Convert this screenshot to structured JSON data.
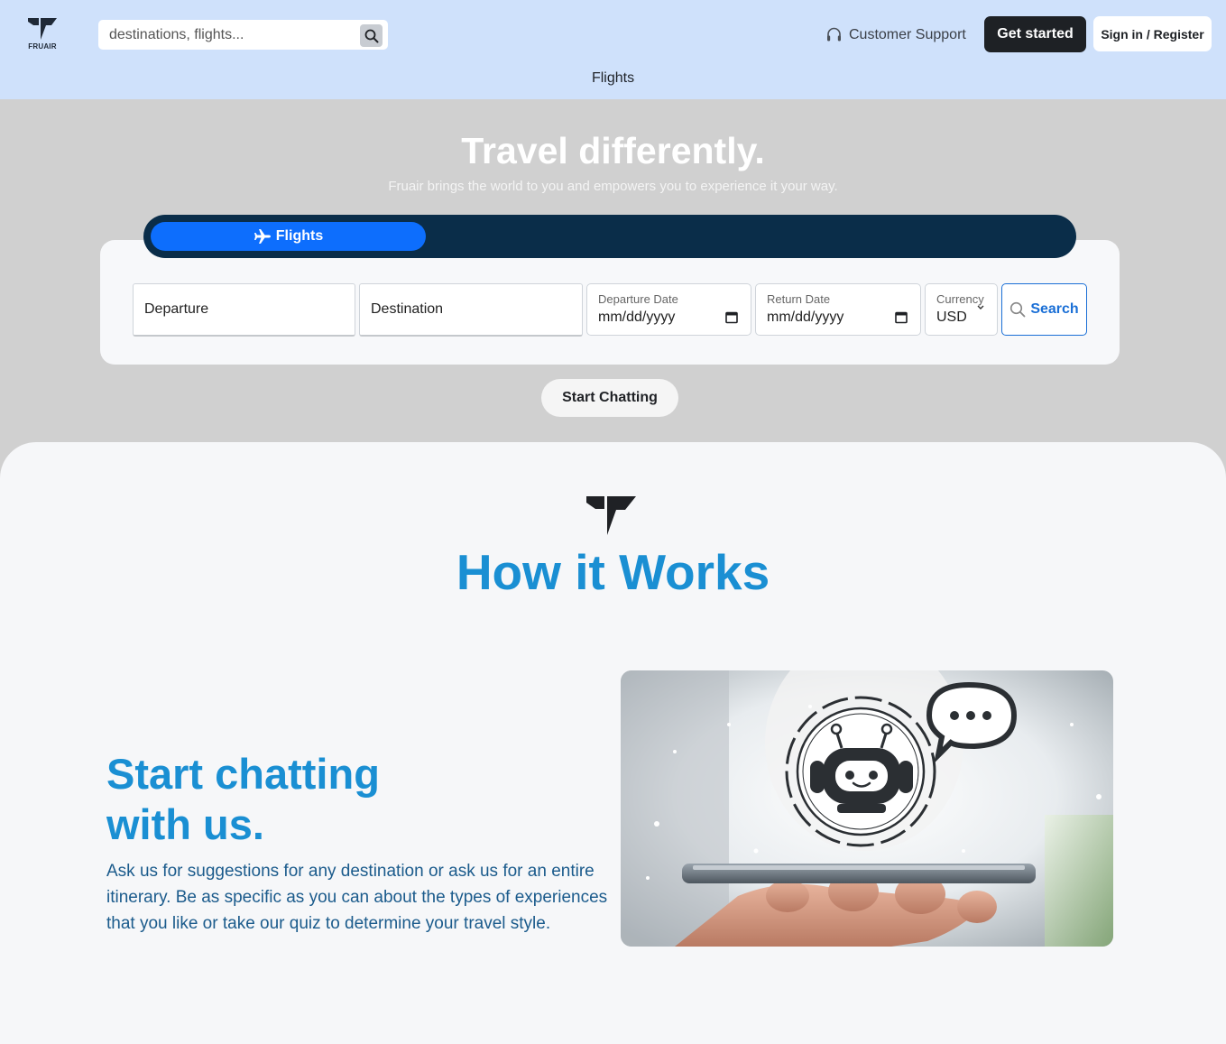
{
  "brand": {
    "name": "FRUAIR"
  },
  "header": {
    "search_placeholder": "destinations, flights...",
    "support_label": "Customer Support",
    "get_started_label": "Get started",
    "signin_label": "Sign in / Register",
    "nav_flights": "Flights"
  },
  "hero": {
    "title": "Travel differently.",
    "subtitle": "Fruair brings the world to you and empowers you to experience it your way.",
    "tab_flights": "Flights"
  },
  "search_form": {
    "departure_placeholder": "Departure",
    "destination_placeholder": "Destination",
    "departure_date_label": "Departure Date",
    "departure_date_value": "mm/dd/yyyy",
    "return_date_label": "Return Date",
    "return_date_value": "mm/dd/yyyy",
    "currency_label": "Currency",
    "currency_value": "USD",
    "search_label": "Search"
  },
  "chat_button_label": "Start Chatting",
  "how_it_works": {
    "title": "How it Works",
    "chat_title": "Start chatting with us.",
    "chat_desc": "Ask us for suggestions for any destination or ask us for an entire itinerary. Be as specific as you can about the types of experiences that you like or take our quiz to determine your travel style."
  },
  "colors": {
    "header_bg": "#cfe1fb",
    "hero_bg": "#d0d0d0",
    "tabbar_bg": "#0a2d49",
    "accent_blue": "#0d6efd",
    "title_blue": "#1a8fd3",
    "dark_button": "#1e2125"
  },
  "icons": {
    "logo": "fruair-logo-icon",
    "search": "search-icon",
    "support": "headset-icon",
    "plane": "airplane-icon",
    "calendar": "calendar-icon",
    "chevron": "chevron-down-icon",
    "chatbot": "chatbot-illustration"
  }
}
